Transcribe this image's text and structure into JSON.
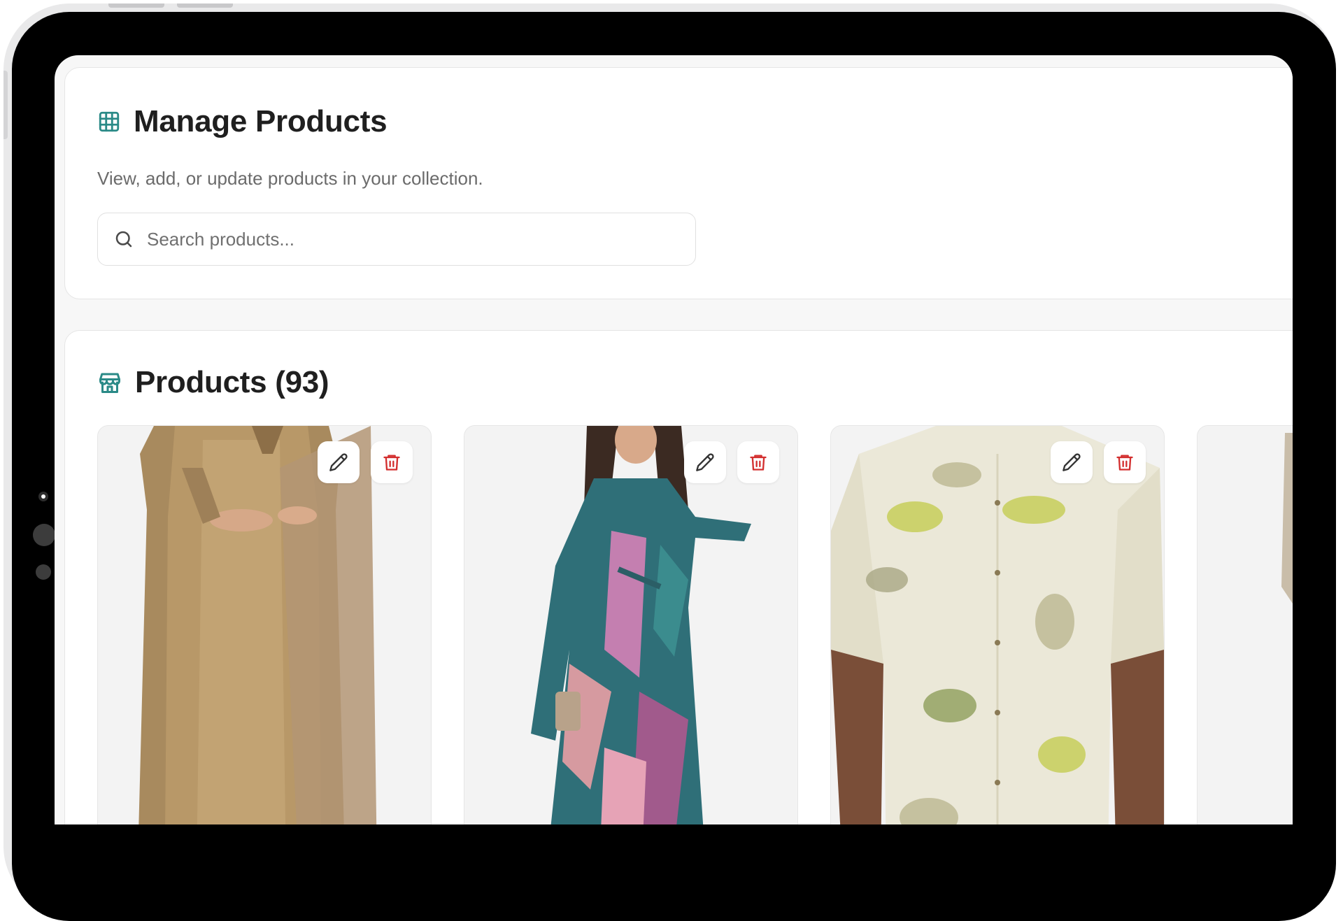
{
  "manage": {
    "title": "Manage Products",
    "subtitle": "View, add, or update products in your collection.",
    "search_placeholder": "Search products..."
  },
  "products_section": {
    "title": "Products (93)"
  },
  "products": [
    {
      "image": "woman-in-golden-kurta-with-dupatta"
    },
    {
      "image": "woman-in-teal-pink-print-dress"
    },
    {
      "image": "man-in-cream-floral-leaf-shirt"
    },
    {
      "image": "partial-product-image"
    }
  ],
  "colors": {
    "accent": "#2a8a87",
    "delete": "#d32f2f",
    "bezel": "#000000"
  }
}
